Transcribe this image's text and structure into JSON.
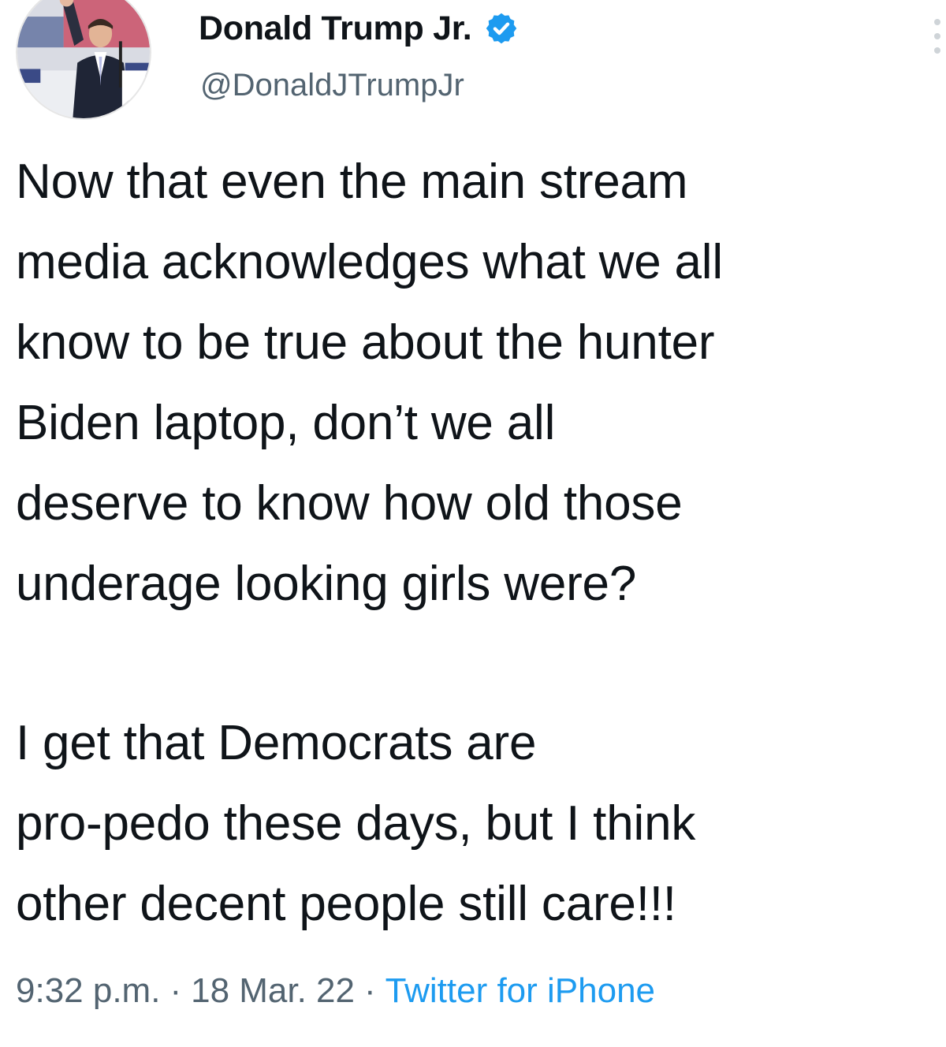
{
  "author": {
    "display_name": "Donald Trump Jr.",
    "handle": "@DonaldJTrumpJr",
    "verified": true,
    "verified_color": "#1d9bf0"
  },
  "tweet": {
    "lines_paragraph_1": [
      "Now that even the main stream",
      "media acknowledges what we all",
      "know to be true about the hunter",
      "Biden laptop, don’t we all",
      "deserve to know how old those",
      "underage looking girls were?"
    ],
    "lines_paragraph_2": [
      "I get that Democrats are",
      "pro-pedo these days, but I think",
      "other decent people still care!!!"
    ]
  },
  "meta": {
    "time": "9:32 p.m.",
    "separator": "·",
    "date": "18 Mar. 22",
    "source": "Twitter for iPhone"
  },
  "icons": {
    "verified": "verified-badge-icon",
    "more": "more-options-icon"
  },
  "colors": {
    "text": "#0f1419",
    "secondary": "#536471",
    "link": "#1d9bf0"
  }
}
